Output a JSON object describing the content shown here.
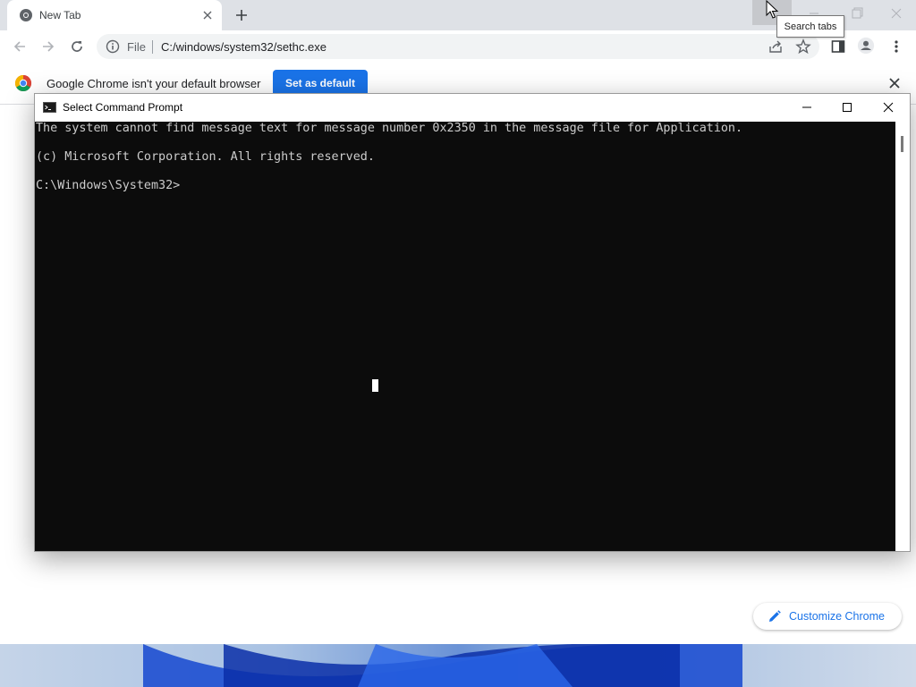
{
  "browser": {
    "tab": {
      "title": "New Tab"
    },
    "tooltip": "Search tabs",
    "toolbar": {
      "scheme": "File",
      "url": "C:/windows/system32/sethc.exe"
    },
    "infobar": {
      "message": "Google Chrome isn't your default browser",
      "button": "Set as default"
    },
    "customize": {
      "label": "Customize Chrome"
    }
  },
  "cmd": {
    "title": "Select Command Prompt",
    "lines": [
      "The system cannot find message text for message number 0x2350 in the message file for Application.",
      "(c) Microsoft Corporation. All rights reserved.",
      "C:\\Windows\\System32>"
    ]
  },
  "icons": {
    "tab_favicon": "chrome-favicon-icon",
    "accent": "#1a73e8"
  }
}
